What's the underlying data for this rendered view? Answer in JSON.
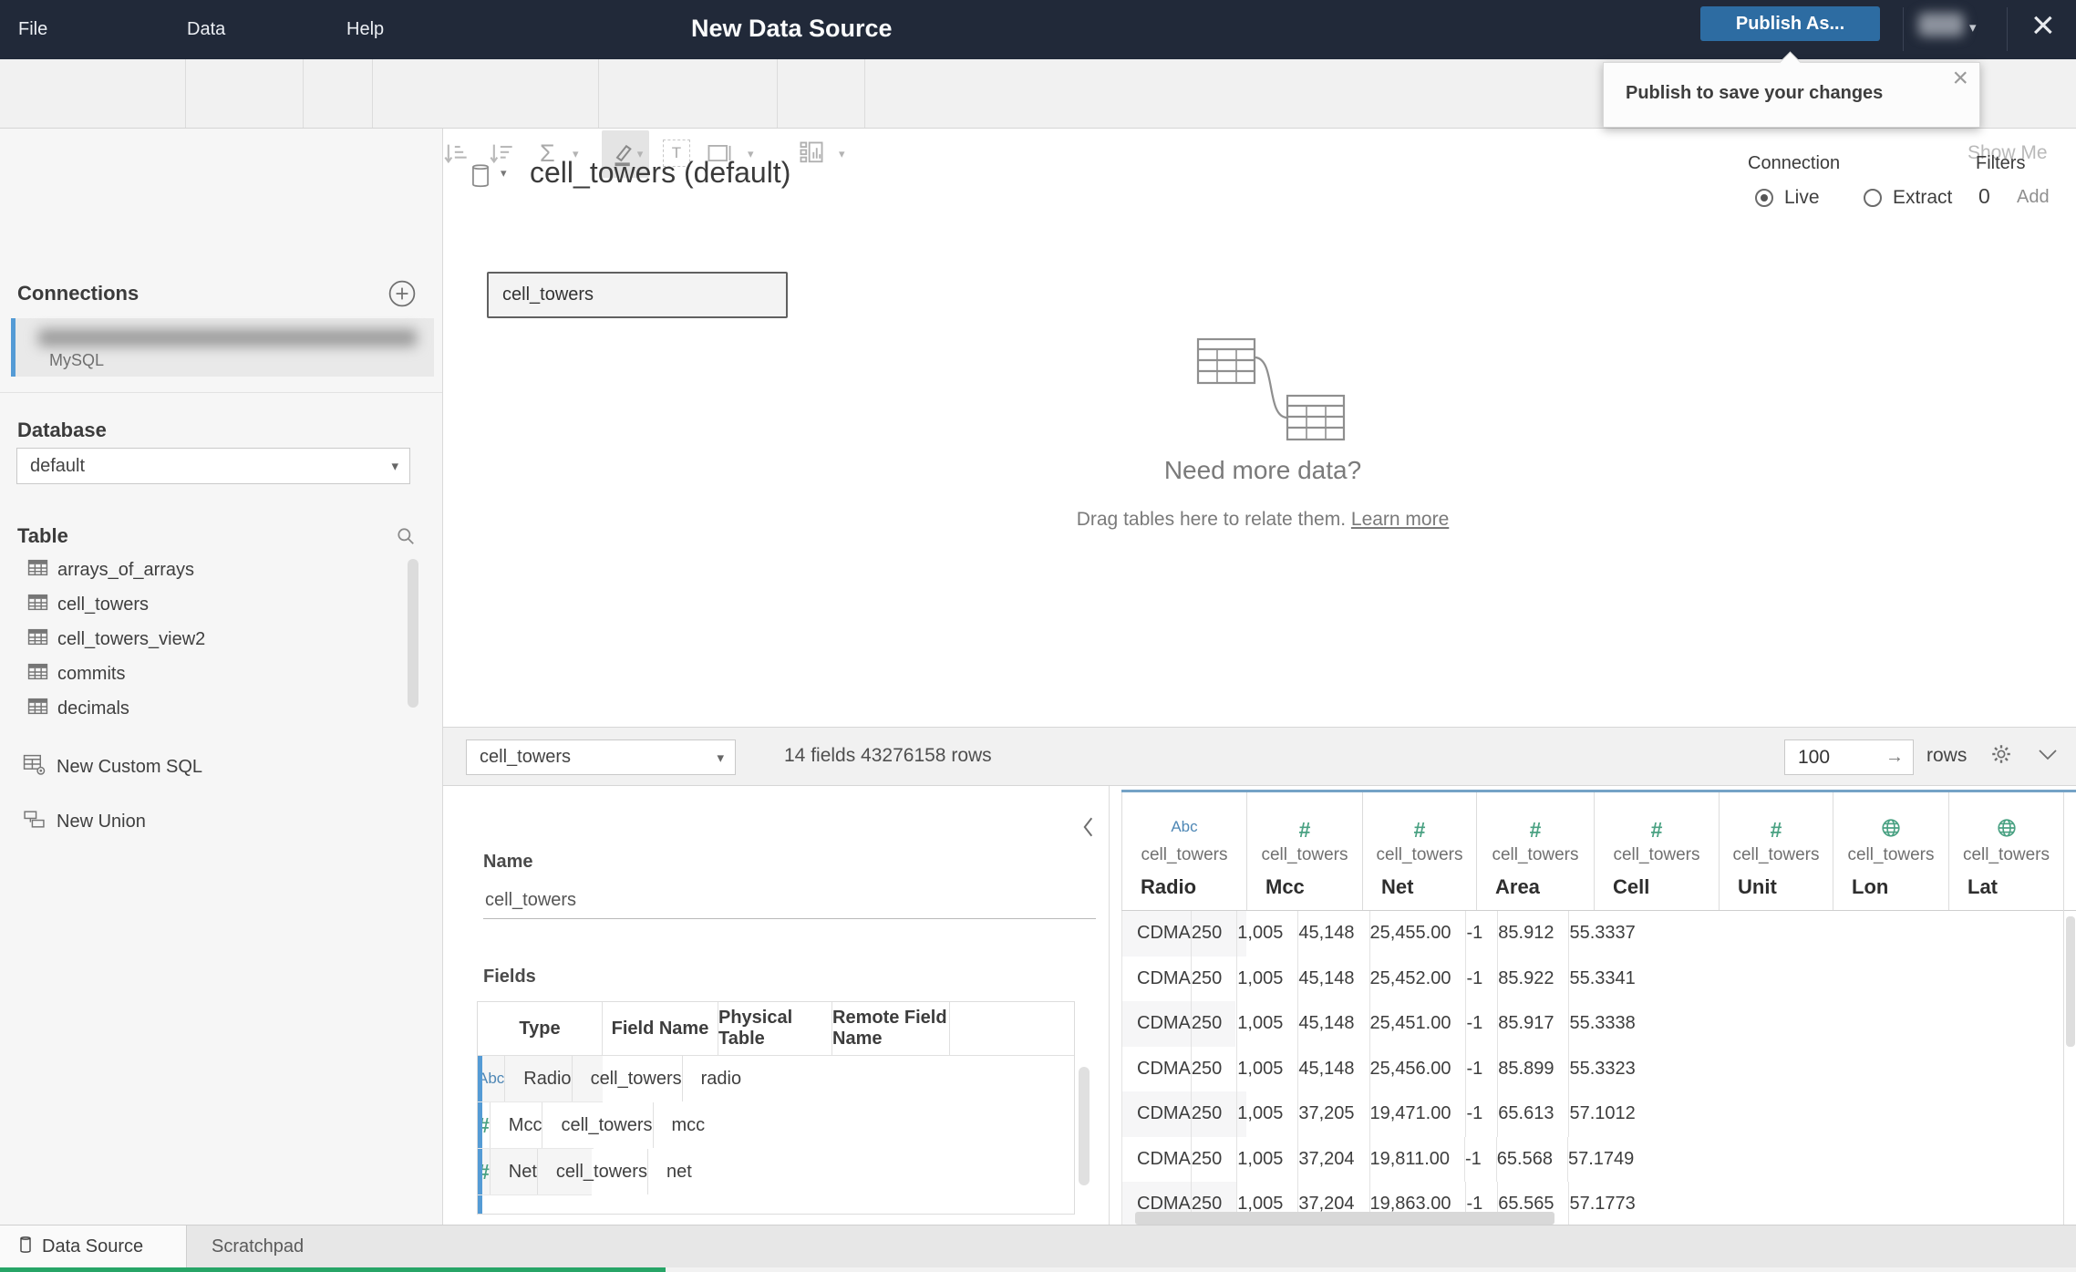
{
  "top_bar": {
    "menus": [
      "File",
      "Data",
      "Help"
    ],
    "title": "New Data Source",
    "publish_label": "Publish As...",
    "close_glyph": "×"
  },
  "tooltip": {
    "text": "Publish to save your changes",
    "close_glyph": "×"
  },
  "toolbar": {
    "sigma_glyph": "Σ",
    "text_tool_glyph": "T",
    "show_me_label": "Show Me"
  },
  "sidebar": {
    "connections_header": "Connections",
    "connection": {
      "type": "MySQL"
    },
    "database_header": "Database",
    "database_value": "default",
    "table_header": "Table",
    "tables": [
      "arrays_of_arrays",
      "cell_towers",
      "cell_towers_view2",
      "commits",
      "decimals"
    ],
    "new_custom_sql": "New Custom SQL",
    "new_union": "New Union"
  },
  "canvas": {
    "datasource_title": "cell_towers (default)",
    "connection_label": "Connection",
    "connection_options": [
      {
        "label": "Live",
        "selected": true
      },
      {
        "label": "Extract",
        "selected": false
      }
    ],
    "filters_label": "Filters",
    "filters_count": "0",
    "filters_add_label": "Add",
    "table_node_label": "cell_towers",
    "empty_state": {
      "heading": "Need more data?",
      "body": "Drag tables here to relate them. ",
      "link": "Learn more"
    }
  },
  "meta_bar": {
    "table_select_value": "cell_towers",
    "summary": "14 fields 43276158 rows",
    "row_count_value": "100",
    "rows_label": "rows"
  },
  "fields_panel": {
    "name_label": "Name",
    "name_value": "cell_towers",
    "fields_label": "Fields",
    "columns": [
      "Type",
      "Field Name",
      "Physical Table",
      "Remote Field Name"
    ],
    "rows": [
      {
        "type_name": "string",
        "type_glyph": "Abc",
        "field": "Radio",
        "table": "cell_towers",
        "remote": "radio"
      },
      {
        "type_name": "number",
        "type_glyph": "#",
        "field": "Mcc",
        "table": "cell_towers",
        "remote": "mcc"
      },
      {
        "type_name": "number",
        "type_glyph": "#",
        "field": "Net",
        "table": "cell_towers",
        "remote": "net"
      }
    ]
  },
  "grid": {
    "columns": [
      {
        "type_name": "string",
        "type_glyph": "Abc",
        "table": "cell_towers",
        "name": "Radio"
      },
      {
        "type_name": "number",
        "type_glyph": "#",
        "table": "cell_towers",
        "name": "Mcc"
      },
      {
        "type_name": "number",
        "type_glyph": "#",
        "table": "cell_towers",
        "name": "Net"
      },
      {
        "type_name": "number",
        "type_glyph": "#",
        "table": "cell_towers",
        "name": "Area"
      },
      {
        "type_name": "number",
        "type_glyph": "#",
        "table": "cell_towers",
        "name": "Cell"
      },
      {
        "type_name": "number",
        "type_glyph": "#",
        "table": "cell_towers",
        "name": "Unit"
      },
      {
        "type_name": "geo",
        "type_glyph": "",
        "table": "cell_towers",
        "name": "Lon"
      },
      {
        "type_name": "geo",
        "type_glyph": "",
        "table": "cell_towers",
        "name": "Lat"
      }
    ],
    "rows": [
      [
        "CDMA",
        "250",
        "1,005",
        "45,148",
        "25,455.00",
        "-1",
        "85.912",
        "55.3337"
      ],
      [
        "CDMA",
        "250",
        "1,005",
        "45,148",
        "25,452.00",
        "-1",
        "85.922",
        "55.3341"
      ],
      [
        "CDMA",
        "250",
        "1,005",
        "45,148",
        "25,451.00",
        "-1",
        "85.917",
        "55.3338"
      ],
      [
        "CDMA",
        "250",
        "1,005",
        "45,148",
        "25,456.00",
        "-1",
        "85.899",
        "55.3323"
      ],
      [
        "CDMA",
        "250",
        "1,005",
        "37,205",
        "19,471.00",
        "-1",
        "65.613",
        "57.1012"
      ],
      [
        "CDMA",
        "250",
        "1,005",
        "37,204",
        "19,811.00",
        "-1",
        "65.568",
        "57.1749"
      ],
      [
        "CDMA",
        "250",
        "1,005",
        "37,204",
        "19,863.00",
        "-1",
        "65.565",
        "57.1773"
      ]
    ]
  },
  "footer": {
    "tabs": [
      {
        "label": "Data Source",
        "active": true
      },
      {
        "label": "Scratchpad",
        "active": false
      }
    ]
  }
}
